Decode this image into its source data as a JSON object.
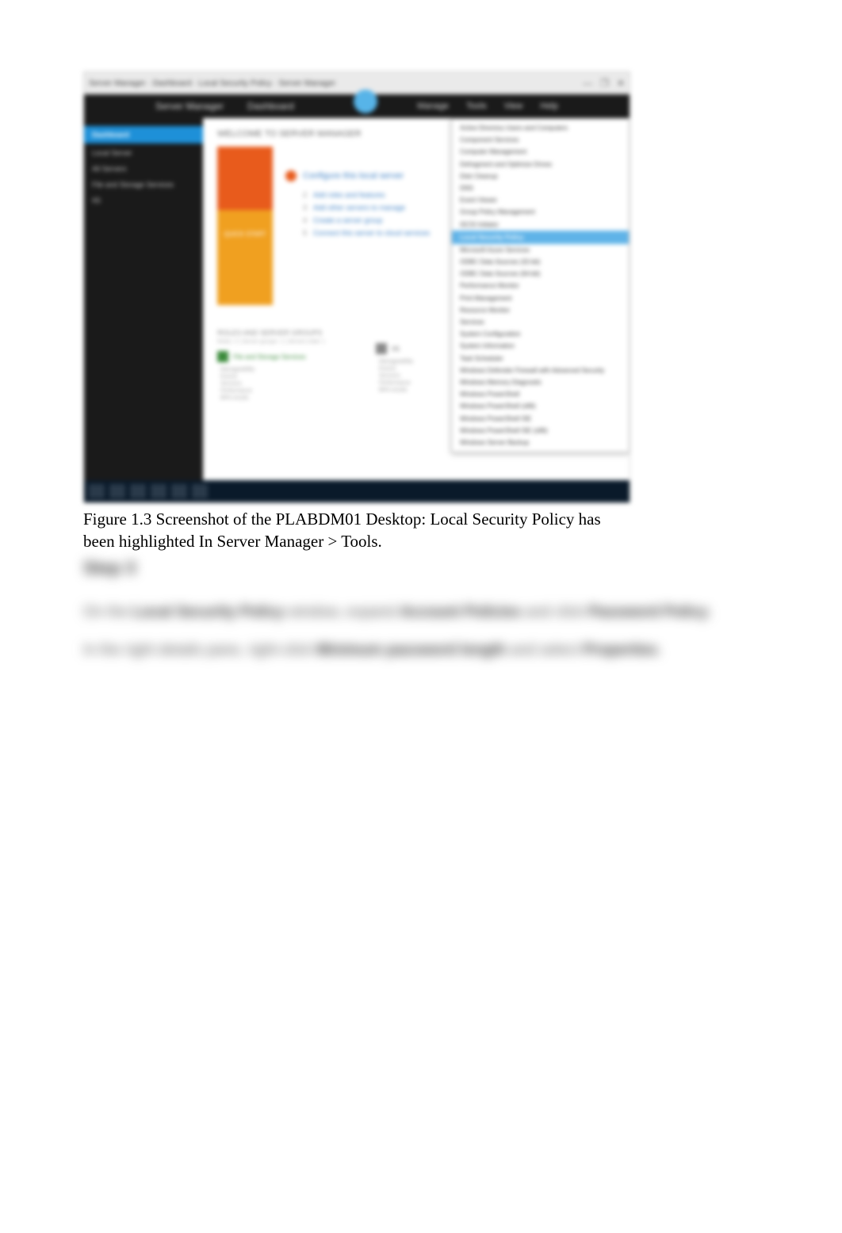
{
  "window": {
    "title": "Server Manager · Dashboard · Local Security Policy · Server Manager",
    "controls": {
      "min": "—",
      "max": "❐",
      "close": "✕"
    }
  },
  "ribbon": {
    "left1": "Server Manager",
    "left2": "Dashboard",
    "r_manage": "Manage",
    "r_tools": "Tools",
    "r_view": "View",
    "r_help": "Help"
  },
  "sidebar": {
    "items": [
      {
        "label": "Dashboard",
        "selected": true
      },
      {
        "label": "Local Server",
        "selected": false
      },
      {
        "label": "All Servers",
        "selected": false
      },
      {
        "label": "File and Storage Services",
        "selected": false
      },
      {
        "label": "IIS",
        "selected": false
      }
    ]
  },
  "welcome": {
    "heading": "WELCOME TO SERVER MANAGER",
    "tile_label": "QUICK START",
    "lead": "Configure this local server",
    "links": [
      "Add roles and features",
      "Add other servers to manage",
      "Create a server group",
      "Connect this server to cloud services"
    ]
  },
  "roles": {
    "header": "ROLES AND SERVER GROUPS",
    "sub": "Roles: 2 | Server groups: 1 | Servers total: 1",
    "block1": {
      "title": "File and Storage Services",
      "lines": [
        "Manageability",
        "Events",
        "Services",
        "Performance",
        "BPA results"
      ]
    },
    "block2": {
      "title": "IIS",
      "lines": [
        "Manageability",
        "Events",
        "Services",
        "Performance",
        "BPA results"
      ]
    }
  },
  "tools_menu": {
    "items_top": [
      "Active Directory Users and Computers",
      "Component Services",
      "Computer Management",
      "Defragment and Optimize Drives",
      "Disk Cleanup",
      "DNS",
      "Event Viewer",
      "Group Policy Management",
      "iSCSI Initiator"
    ],
    "highlight": "Local Security Policy",
    "items_bottom": [
      "Microsoft Azure Services",
      "ODBC Data Sources (32-bit)",
      "ODBC Data Sources (64-bit)",
      "Performance Monitor",
      "Print Management",
      "Resource Monitor",
      "Services",
      "System Configuration",
      "System Information",
      "Task Scheduler",
      "Windows Defender Firewall with Advanced Security",
      "Windows Memory Diagnostic",
      "Windows PowerShell",
      "Windows PowerShell (x86)",
      "Windows PowerShell ISE",
      "Windows PowerShell ISE (x86)",
      "Windows Server Backup"
    ]
  },
  "caption": "Figure 1.3 Screenshot of the PLABDM01 Desktop: Local Security Policy has been highlighted In Server Manager > Tools.",
  "step": {
    "heading": "Step 3",
    "p1a": "On the ",
    "p1b": "Local Security Policy",
    "p1c": " window, expand ",
    "p1d": "Account Policies",
    "p1e": " and click ",
    "p1f": "Password Policy",
    "p1g": ".",
    "p2a": "In the right details pane, right-click ",
    "p2b": "Minimum password length",
    "p2c": " and select ",
    "p2d": "Properties",
    "p2e": "."
  }
}
